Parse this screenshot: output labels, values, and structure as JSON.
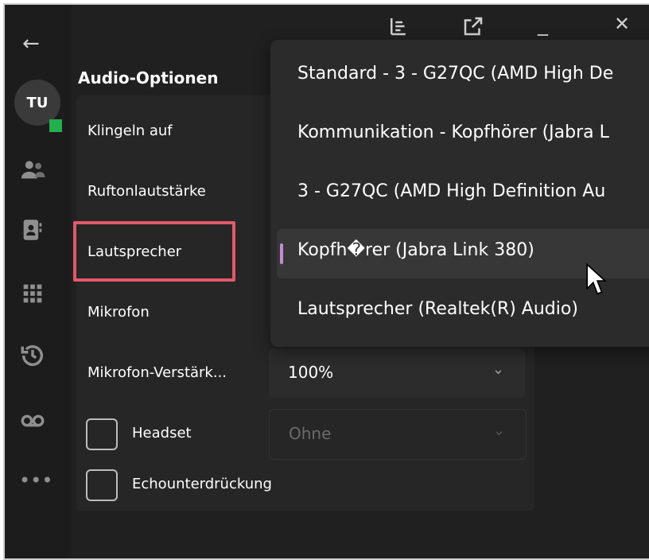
{
  "sidebar": {
    "avatar_initials": "TU",
    "presence_color": "#22b14c"
  },
  "section": {
    "title": "Audio-Optionen"
  },
  "settings": {
    "klingeln_label": "Klingeln auf",
    "rufton_label": "Ruftonlautstärke",
    "lautsprecher_label": "Lautsprecher",
    "mikrofon_label": "Mikrofon",
    "mikrofon_verst_label": "Mikrofon-Verstärk...",
    "mikrofon_verst_value": "100%",
    "headset_label": "Headset",
    "headset_value": "Ohne",
    "echo_label": "Echounterdrückung"
  },
  "dropdown": {
    "options": [
      {
        "label": "Standard - 3 - G27QC (AMD High De"
      },
      {
        "label": "Kommunikation - Kopfhörer (Jabra L"
      },
      {
        "label": "3 - G27QC (AMD High Definition Au"
      },
      {
        "label": "Kopfh�rer (Jabra Link 380)"
      },
      {
        "label": "Lautsprecher (Realtek(R) Audio)"
      }
    ],
    "selected_index": 3
  },
  "colors": {
    "highlight": "#e0596a",
    "selection_indicator": "#c78ad6"
  }
}
